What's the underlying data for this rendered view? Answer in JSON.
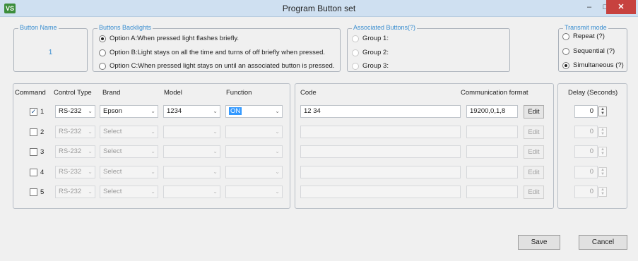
{
  "window": {
    "icon_text": "VS",
    "title": "Program Button set",
    "min_glyph": "–",
    "max_glyph": "□",
    "close_glyph": "✕"
  },
  "button_name": {
    "legend": "Button  Name",
    "value": "1"
  },
  "backlights": {
    "legend": "Buttons Backlights",
    "options": [
      {
        "label": "Option A:When pressed light flashes briefly.",
        "selected": true
      },
      {
        "label": "Option B:Light stays on all the time and turns of off briefly when pressed.",
        "selected": false
      },
      {
        "label": "Option C:When pressed light stays on until an associated button is pressed.",
        "selected": false
      }
    ]
  },
  "associated": {
    "legend": "Associated Buttons(?)",
    "groups": [
      "Group 1:",
      "Group 2:",
      "Group 3:"
    ]
  },
  "transmit": {
    "legend": "Transmit mode",
    "options": [
      {
        "label": "Repeat (?)",
        "selected": false
      },
      {
        "label": "Sequential (?)",
        "selected": false
      },
      {
        "label": "Simultaneous (?)",
        "selected": true
      }
    ]
  },
  "headers": {
    "command": "Command",
    "control_type": "Control Type",
    "brand": "Brand",
    "model": "Model",
    "function": "Function",
    "code": "Code",
    "comm_format": "Communication format",
    "delay": "Delay (Seconds)"
  },
  "rows": [
    {
      "num": "1",
      "checked": true,
      "check_glyph": "✓",
      "control_type": "RS-232",
      "brand": "Epson",
      "model": "1234",
      "function": "ON",
      "code": "12 34",
      "comm_format": "19200,0,1,8",
      "edit": "Edit",
      "delay": "0",
      "enabled": true
    },
    {
      "num": "2",
      "checked": false,
      "check_glyph": "",
      "control_type": "RS-232",
      "brand": "Select",
      "model": "",
      "function": "",
      "code": "",
      "comm_format": "",
      "edit": "Edit",
      "delay": "0",
      "enabled": false
    },
    {
      "num": "3",
      "checked": false,
      "check_glyph": "",
      "control_type": "RS-232",
      "brand": "Select",
      "model": "",
      "function": "",
      "code": "",
      "comm_format": "",
      "edit": "Edit",
      "delay": "0",
      "enabled": false
    },
    {
      "num": "4",
      "checked": false,
      "check_glyph": "",
      "control_type": "RS-232",
      "brand": "Select",
      "model": "",
      "function": "",
      "code": "",
      "comm_format": "",
      "edit": "Edit",
      "delay": "0",
      "enabled": false
    },
    {
      "num": "5",
      "checked": false,
      "check_glyph": "",
      "control_type": "RS-232",
      "brand": "Select",
      "model": "",
      "function": "",
      "code": "",
      "comm_format": "",
      "edit": "Edit",
      "delay": "0",
      "enabled": false
    }
  ],
  "footer": {
    "save": "Save",
    "cancel": "Cancel"
  },
  "glyphs": {
    "dropdown": "⌄",
    "spin_up": "▲",
    "spin_down": "▼"
  }
}
